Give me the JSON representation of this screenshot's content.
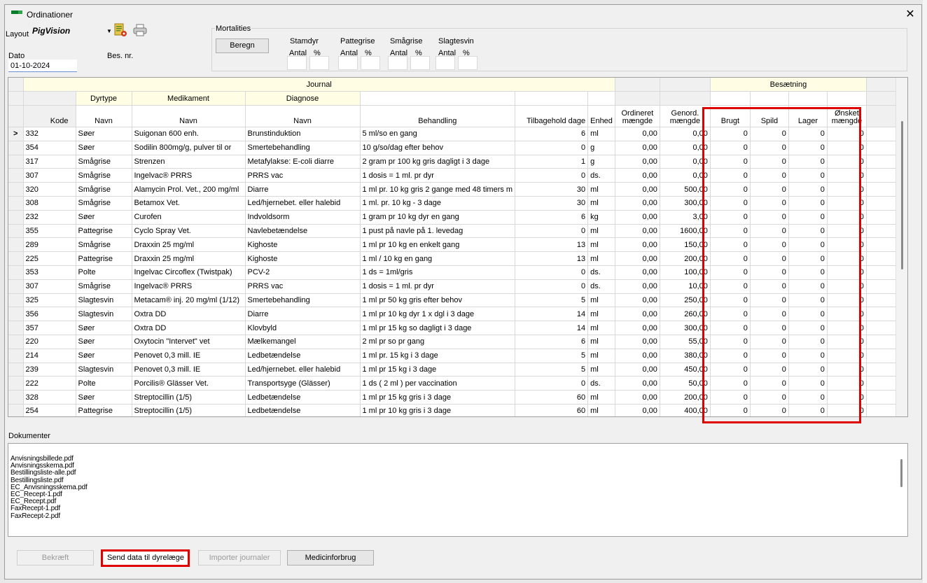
{
  "window": {
    "title": "Ordinationer",
    "close_glyph": "✕"
  },
  "layout": {
    "label": "Layout",
    "value": "PigVision"
  },
  "dato": {
    "label": "Dato",
    "value": "01-10-2024"
  },
  "bes_nr": {
    "label": "Bes. nr."
  },
  "mortalities": {
    "title": "Mortalities",
    "button": "Beregn",
    "groups": [
      "Stamdyr",
      "Pattegrise",
      "Smågrise",
      "Slagtesvin"
    ],
    "antal": "Antal",
    "pct": "%"
  },
  "grid": {
    "journal_header": "Journal",
    "besaetning_header": "Besætning",
    "group_headers": {
      "dyrtype": "Dyrtype",
      "medikament": "Medikament",
      "diagnose": "Diagnose"
    },
    "columns": {
      "kode": "Kode",
      "navn": "Navn",
      "behandling": "Behandling",
      "tilbagehold": "Tilbagehold dage",
      "enhed": "Enhed",
      "ordineret": "Ordineret mængde",
      "genord": "Genord. mængde",
      "brugt": "Brugt",
      "spild": "Spild",
      "lager": "Lager",
      "onsket": "Ønsket mængde"
    },
    "current_row_marker": ">",
    "rows": [
      {
        "kode": "332",
        "dyr": "Søer",
        "med": "Suigonan 600 enh.",
        "diag": "Brunstinduktion",
        "beh": "5 ml/so en gang",
        "dage": "6",
        "enh": "ml",
        "ord": "0,00",
        "gen": "0,00",
        "brugt": "0",
        "spild": "0",
        "lager": "0",
        "onsket": "0"
      },
      {
        "kode": "354",
        "dyr": "Søer",
        "med": "Sodilin 800mg/g, pulver til or",
        "diag": "Smertebehandling",
        "beh": "10 g/so/dag efter behov",
        "dage": "0",
        "enh": "g",
        "ord": "0,00",
        "gen": "0,00",
        "brugt": "0",
        "spild": "0",
        "lager": "0",
        "onsket": "0"
      },
      {
        "kode": "317",
        "dyr": "Smågrise",
        "med": "Strenzen",
        "diag": "Metafylakse: E-coli diarre",
        "beh": "2 gram pr 100 kg gris dagligt i 3 dage",
        "dage": "1",
        "enh": "g",
        "ord": "0,00",
        "gen": "0,00",
        "brugt": "0",
        "spild": "0",
        "lager": "0",
        "onsket": "0"
      },
      {
        "kode": "307",
        "dyr": "Smågrise",
        "med": "Ingelvac® PRRS",
        "diag": "PRRS vac",
        "beh": "1 dosis = 1 ml. pr dyr",
        "dage": "0",
        "enh": "ds.",
        "ord": "0,00",
        "gen": "0,00",
        "brugt": "0",
        "spild": "0",
        "lager": "0",
        "onsket": "0"
      },
      {
        "kode": "320",
        "dyr": "Smågrise",
        "med": "Alamycin Prol. Vet., 200 mg/ml",
        "diag": "Diarre",
        "beh": "1 ml pr. 10 kg gris 2 gange med 48 timers m",
        "dage": "30",
        "enh": "ml",
        "ord": "0,00",
        "gen": "500,00",
        "brugt": "0",
        "spild": "0",
        "lager": "0",
        "onsket": "0"
      },
      {
        "kode": "308",
        "dyr": "Smågrise",
        "med": "Betamox Vet.",
        "diag": "Led/hjernebet. eller halebid",
        "beh": "1 ml. pr. 10 kg - 3 dage",
        "dage": "30",
        "enh": "ml",
        "ord": "0,00",
        "gen": "300,00",
        "brugt": "0",
        "spild": "0",
        "lager": "0",
        "onsket": "0"
      },
      {
        "kode": "232",
        "dyr": "Søer",
        "med": "Curofen",
        "diag": "Indvoldsorm",
        "beh": "1 gram pr 10 kg dyr en gang",
        "dage": "6",
        "enh": "kg",
        "ord": "0,00",
        "gen": "3,00",
        "brugt": "0",
        "spild": "0",
        "lager": "0",
        "onsket": "0"
      },
      {
        "kode": "355",
        "dyr": "Pattegrise",
        "med": "Cyclo Spray Vet.",
        "diag": "Navlebetændelse",
        "beh": "1 pust på navle på 1. levedag",
        "dage": "0",
        "enh": "ml",
        "ord": "0,00",
        "gen": "1600,00",
        "brugt": "0",
        "spild": "0",
        "lager": "0",
        "onsket": "0"
      },
      {
        "kode": "289",
        "dyr": "Smågrise",
        "med": "Draxxin 25 mg/ml",
        "diag": "Kighoste",
        "beh": "1 ml pr 10 kg en enkelt gang",
        "dage": "13",
        "enh": "ml",
        "ord": "0,00",
        "gen": "150,00",
        "brugt": "0",
        "spild": "0",
        "lager": "0",
        "onsket": "0"
      },
      {
        "kode": "225",
        "dyr": "Pattegrise",
        "med": "Draxxin 25 mg/ml",
        "diag": "Kighoste",
        "beh": "1 ml / 10 kg en gang",
        "dage": "13",
        "enh": "ml",
        "ord": "0,00",
        "gen": "200,00",
        "brugt": "0",
        "spild": "0",
        "lager": "0",
        "onsket": "0"
      },
      {
        "kode": "353",
        "dyr": "Polte",
        "med": "Ingelvac Circoflex (Twistpak)",
        "diag": "PCV-2",
        "beh": "1 ds = 1ml/gris",
        "dage": "0",
        "enh": "ds.",
        "ord": "0,00",
        "gen": "100,00",
        "brugt": "0",
        "spild": "0",
        "lager": "0",
        "onsket": "0"
      },
      {
        "kode": "307",
        "dyr": "Smågrise",
        "med": "Ingelvac® PRRS",
        "diag": "PRRS vac",
        "beh": "1 dosis = 1 ml. pr dyr",
        "dage": "0",
        "enh": "ds.",
        "ord": "0,00",
        "gen": "10,00",
        "brugt": "0",
        "spild": "0",
        "lager": "0",
        "onsket": "0"
      },
      {
        "kode": "325",
        "dyr": "Slagtesvin",
        "med": "Metacam® inj. 20 mg/ml (1/12)",
        "diag": "Smertebehandling",
        "beh": "1 ml pr 50 kg gris efter behov",
        "dage": "5",
        "enh": "ml",
        "ord": "0,00",
        "gen": "250,00",
        "brugt": "0",
        "spild": "0",
        "lager": "0",
        "onsket": "0"
      },
      {
        "kode": "356",
        "dyr": "Slagtesvin",
        "med": "Oxtra DD",
        "diag": "Diarre",
        "beh": "1 ml pr 10 kg dyr 1 x dgl i 3 dage",
        "dage": "14",
        "enh": "ml",
        "ord": "0,00",
        "gen": "260,00",
        "brugt": "0",
        "spild": "0",
        "lager": "0",
        "onsket": "0"
      },
      {
        "kode": "357",
        "dyr": "Søer",
        "med": "Oxtra DD",
        "diag": "Klovbyld",
        "beh": "1 ml pr 15 kg so dagligt i 3 dage",
        "dage": "14",
        "enh": "ml",
        "ord": "0,00",
        "gen": "300,00",
        "brugt": "0",
        "spild": "0",
        "lager": "0",
        "onsket": "0"
      },
      {
        "kode": "220",
        "dyr": "Søer",
        "med": "Oxytocin \"Intervet\" vet",
        "diag": "Mælkemangel",
        "beh": "2 ml pr so pr gang",
        "dage": "6",
        "enh": "ml",
        "ord": "0,00",
        "gen": "55,00",
        "brugt": "0",
        "spild": "0",
        "lager": "0",
        "onsket": "0"
      },
      {
        "kode": "214",
        "dyr": "Søer",
        "med": "Penovet 0,3 mill. IE",
        "diag": "Ledbetændelse",
        "beh": "1 ml pr. 15 kg i 3 dage",
        "dage": "5",
        "enh": "ml",
        "ord": "0,00",
        "gen": "380,00",
        "brugt": "0",
        "spild": "0",
        "lager": "0",
        "onsket": "0"
      },
      {
        "kode": "239",
        "dyr": "Slagtesvin",
        "med": "Penovet 0,3 mill. IE",
        "diag": "Led/hjernebet. eller halebid",
        "beh": "1 ml pr 15 kg i 3 dage",
        "dage": "5",
        "enh": "ml",
        "ord": "0,00",
        "gen": "450,00",
        "brugt": "0",
        "spild": "0",
        "lager": "0",
        "onsket": "0"
      },
      {
        "kode": "222",
        "dyr": "Polte",
        "med": "Porcilis® Glässer Vet.",
        "diag": "Transportsyge (Glässer)",
        "beh": "1 ds ( 2 ml ) per vaccination",
        "dage": "0",
        "enh": "ds.",
        "ord": "0,00",
        "gen": "50,00",
        "brugt": "0",
        "spild": "0",
        "lager": "0",
        "onsket": "0"
      },
      {
        "kode": "328",
        "dyr": "Søer",
        "med": "Streptocillin (1/5)",
        "diag": "Ledbetændelse",
        "beh": "1 ml pr 15 kg gris i 3 dage",
        "dage": "60",
        "enh": "ml",
        "ord": "0,00",
        "gen": "200,00",
        "brugt": "0",
        "spild": "0",
        "lager": "0",
        "onsket": "0"
      },
      {
        "kode": "254",
        "dyr": "Pattegrise",
        "med": "Streptocillin (1/5)",
        "diag": "Ledbetændelse",
        "beh": "1 ml  pr 10 kg gris i 3 dage",
        "dage": "60",
        "enh": "ml",
        "ord": "0,00",
        "gen": "400,00",
        "brugt": "0",
        "spild": "0",
        "lager": "0",
        "onsket": "0"
      }
    ]
  },
  "documents": {
    "label": "Dokumenter",
    "files": [
      "Anvisningsbillede.pdf",
      "Anvisningsskema.pdf",
      "Bestillingsliste-alle.pdf",
      "Bestillingsliste.pdf",
      "EC_Anvisningsskema.pdf",
      "EC_Recept-1.pdf",
      "EC_Recept.pdf",
      "FaxRecept-1.pdf",
      "FaxRecept-2.pdf"
    ]
  },
  "buttons": {
    "bekraeft": "Bekræft",
    "send": "Send data til dyrelæge",
    "importer": "Importer journaler",
    "medicinforbrug": "Medicinforbrug"
  },
  "colors": {
    "highlight": "#e00000",
    "header_yellow": "#fffde3",
    "logo_green": "#0a7d2c"
  }
}
